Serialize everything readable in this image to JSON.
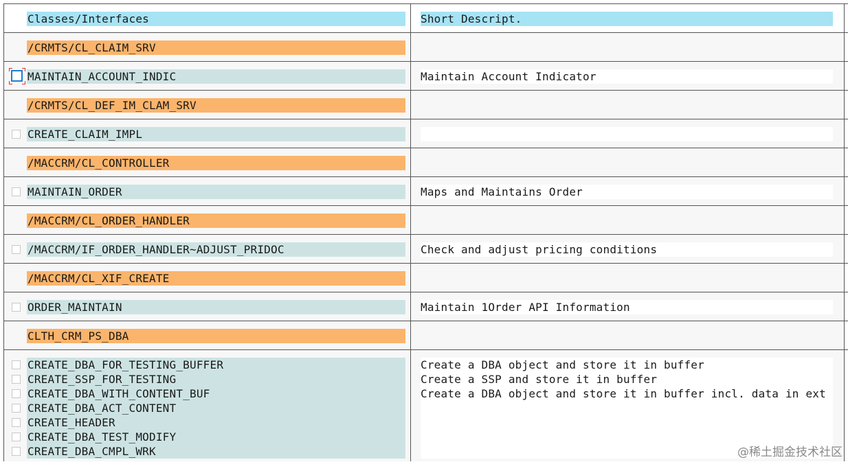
{
  "header": {
    "col1": "Classes/Interfaces",
    "col2": "Short Descript."
  },
  "rows": [
    {
      "kind": "class",
      "name": "/CRMTS/CL_CLAIM_SRV",
      "desc": ""
    },
    {
      "kind": "method",
      "name": "MAINTAIN_ACCOUNT_INDIC",
      "desc": "Maintain Account Indicator",
      "focused": true
    },
    {
      "kind": "class",
      "name": "/CRMTS/CL_DEF_IM_CLAM_SRV",
      "desc": ""
    },
    {
      "kind": "method",
      "name": "CREATE_CLAIM_IMPL",
      "desc": ""
    },
    {
      "kind": "class",
      "name": "/MACCRM/CL_CONTROLLER",
      "desc": ""
    },
    {
      "kind": "method",
      "name": "MAINTAIN_ORDER",
      "desc": "Maps and Maintains Order"
    },
    {
      "kind": "class",
      "name": "/MACCRM/CL_ORDER_HANDLER",
      "desc": ""
    },
    {
      "kind": "method",
      "name": "/MACCRM/IF_ORDER_HANDLER~ADJUST_PRIDOC",
      "desc": "Check and adjust pricing conditions"
    },
    {
      "kind": "class",
      "name": "/MACCRM/CL_XIF_CREATE",
      "desc": ""
    },
    {
      "kind": "method",
      "name": "ORDER_MAINTAIN",
      "desc": "Maintain 1Order API Information"
    },
    {
      "kind": "class",
      "name": "CLTH_CRM_PS_DBA",
      "desc": ""
    }
  ],
  "group": [
    {
      "name": "CREATE_DBA_FOR_TESTING_BUFFER",
      "desc": "Create a DBA object and store it in buffer"
    },
    {
      "name": "CREATE_SSP_FOR_TESTING",
      "desc": "Create a SSP and store it in buffer"
    },
    {
      "name": "CREATE_DBA_WITH_CONTENT_BUF",
      "desc": "Create a DBA object and store it in buffer incl. data in ext"
    },
    {
      "name": "CREATE_DBA_ACT_CONTENT",
      "desc": ""
    },
    {
      "name": "CREATE_HEADER",
      "desc": ""
    },
    {
      "name": "CREATE_DBA_TEST_MODIFY",
      "desc": ""
    },
    {
      "name": "CREATE_DBA_CMPL_WRK",
      "desc": ""
    }
  ],
  "watermark": "@稀土掘金技术社区",
  "colors": {
    "header_bar": "#a6e3f5",
    "class_bar": "#fbb46b",
    "method_bar": "#cde3e3",
    "focus": "#1f7fd0"
  }
}
